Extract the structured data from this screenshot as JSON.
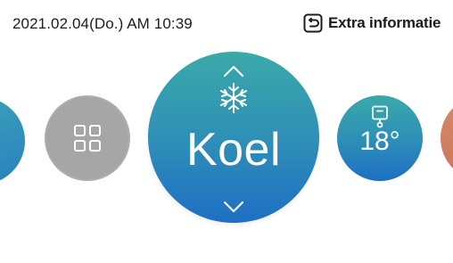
{
  "status_bar": {
    "datetime": "2021.02.04(Do.) AM 10:39",
    "extra_info_label": "Extra informatie",
    "extra_info_icon": "return-icon"
  },
  "carousel": {
    "items": [
      {
        "kind": "partial",
        "icon": "",
        "label": ""
      },
      {
        "kind": "menu",
        "icon": "grid-menu-icon",
        "label": ""
      },
      {
        "kind": "mode",
        "icon": "snowflake-icon",
        "label": "Koel"
      },
      {
        "kind": "temperature",
        "icon": "indoor-temperature-icon",
        "label": "18°"
      },
      {
        "kind": "partial",
        "icon": "",
        "label": ""
      }
    ],
    "selected_mode": "Koel",
    "selected_temperature": "18°"
  },
  "colors": {
    "background": "#ffffff",
    "text": "#1c1c1c",
    "menu_bubble": "#a6a6a6",
    "accent_top": "#3aa9a8",
    "accent_bottom": "#1f6fc4",
    "partial_right": "#c86f58"
  }
}
